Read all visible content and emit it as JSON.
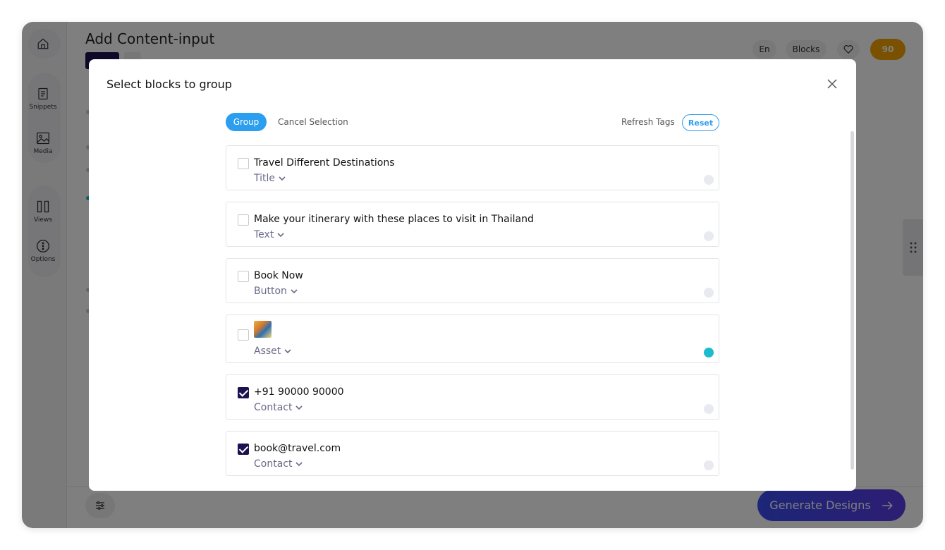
{
  "background": {
    "title": "Add Content-input",
    "lang": "En",
    "blocks_label": "Blocks",
    "coin_count": "90",
    "generate_label": "Generate Designs",
    "sidebar": [
      {
        "label": "Snippets",
        "icon": "snippets-icon"
      },
      {
        "label": "Media",
        "icon": "media-icon"
      },
      {
        "label": "Views",
        "icon": "views-icon"
      },
      {
        "label": "Options",
        "icon": "options-icon"
      }
    ]
  },
  "modal": {
    "title": "Select blocks to group",
    "toolbar": {
      "group_label": "Group",
      "cancel_label": "Cancel Selection",
      "refresh_label": "Refresh Tags",
      "reset_label": "Reset"
    },
    "blocks": [
      {
        "text": "Travel Different Destinations",
        "type": "Title",
        "checked": false,
        "active": false
      },
      {
        "text": "Make your itinerary with these places to visit in Thailand",
        "type": "Text",
        "checked": false,
        "active": false
      },
      {
        "text": "Book Now",
        "type": "Button",
        "checked": false,
        "active": false
      },
      {
        "text": "",
        "type": "Asset",
        "checked": false,
        "active": true
      },
      {
        "text": "+91 90000 90000",
        "type": "Contact",
        "checked": true,
        "active": false
      },
      {
        "text": "book@travel.com",
        "type": "Contact",
        "checked": true,
        "active": false
      }
    ]
  },
  "colors": {
    "accent": "#2c9ef0",
    "checked": "#1c1250",
    "active_indicator": "#1bbccc"
  }
}
